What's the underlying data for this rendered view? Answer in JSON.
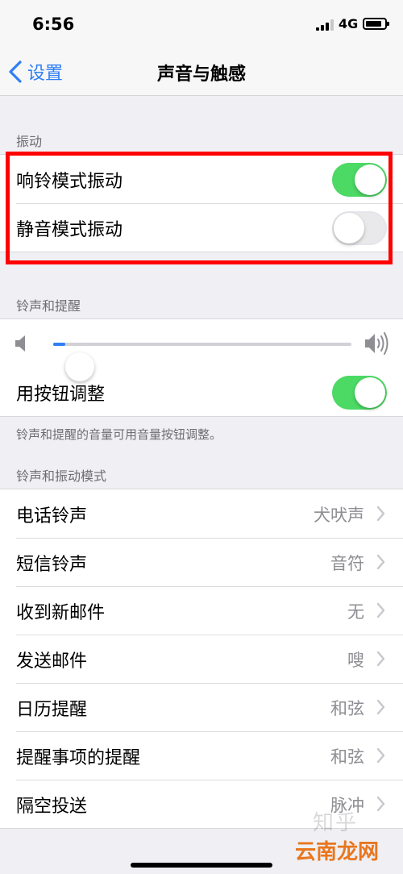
{
  "status": {
    "time": "6:56",
    "network": "4G"
  },
  "nav": {
    "back_label": "设置",
    "title": "声音与触感"
  },
  "sections": {
    "vibration": {
      "header": "振动",
      "items": [
        {
          "label": "响铃模式振动",
          "on": true
        },
        {
          "label": "静音模式振动",
          "on": false
        }
      ]
    },
    "ringer": {
      "header": "铃声和提醒",
      "volume_level": 0.04,
      "button_adjust": {
        "label": "用按钮调整",
        "on": true
      },
      "footer": "铃声和提醒的音量可用音量按钮调整。"
    },
    "patterns": {
      "header": "铃声和振动模式",
      "items": [
        {
          "label": "电话铃声",
          "value": "犬吠声"
        },
        {
          "label": "短信铃声",
          "value": "音符"
        },
        {
          "label": "收到新邮件",
          "value": "无"
        },
        {
          "label": "发送邮件",
          "value": "嗖"
        },
        {
          "label": "日历提醒",
          "value": "和弦"
        },
        {
          "label": "提醒事项的提醒",
          "value": "和弦"
        },
        {
          "label": "隔空投送",
          "value": "脉冲"
        }
      ]
    }
  },
  "watermarks": {
    "zhihu": "知乎",
    "site": "云南龙网"
  },
  "colors": {
    "accent": "#2f7ef5",
    "toggle_on": "#4cd964",
    "highlight": "#ff0000"
  }
}
